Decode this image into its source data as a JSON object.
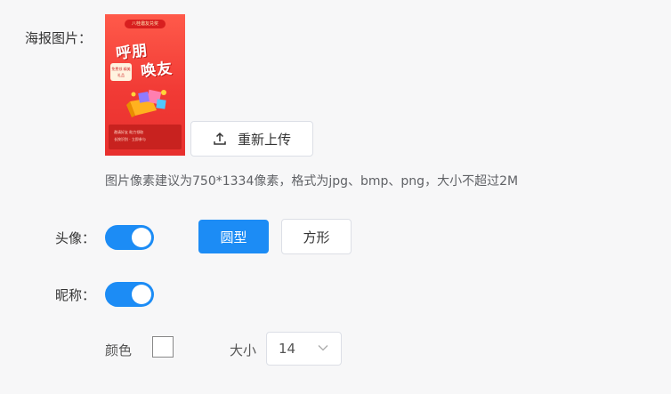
{
  "poster": {
    "label": "海报图片：",
    "image": {
      "ribbon": "八桂邀友兑奖",
      "headline_1": "呼朋",
      "headline_2": "唤友",
      "badge": "免费领 精美礼品",
      "footer_line_1": "邀请好友 助力领取",
      "footer_line_2": "长按识别 · 立即参与"
    },
    "reupload_label": "重新上传",
    "upload_icon": "upload-icon",
    "hint": "图片像素建议为750*1334像素，格式为jpg、bmp、png，大小不超过2M"
  },
  "avatar": {
    "label": "头像：",
    "toggle_on": true,
    "shape_options": [
      "圆型",
      "方形"
    ],
    "selected_shape": "圆型"
  },
  "nickname": {
    "label": "昵称：",
    "toggle_on": true,
    "color_label": "颜色",
    "color_value": "#ffffff",
    "size_label": "大小",
    "size_value": "14",
    "size_icon": "chevron-down-icon"
  },
  "colors": {
    "accent": "#1c8cf5",
    "background": "#f7f7f8",
    "poster_red": "#f13a35"
  }
}
